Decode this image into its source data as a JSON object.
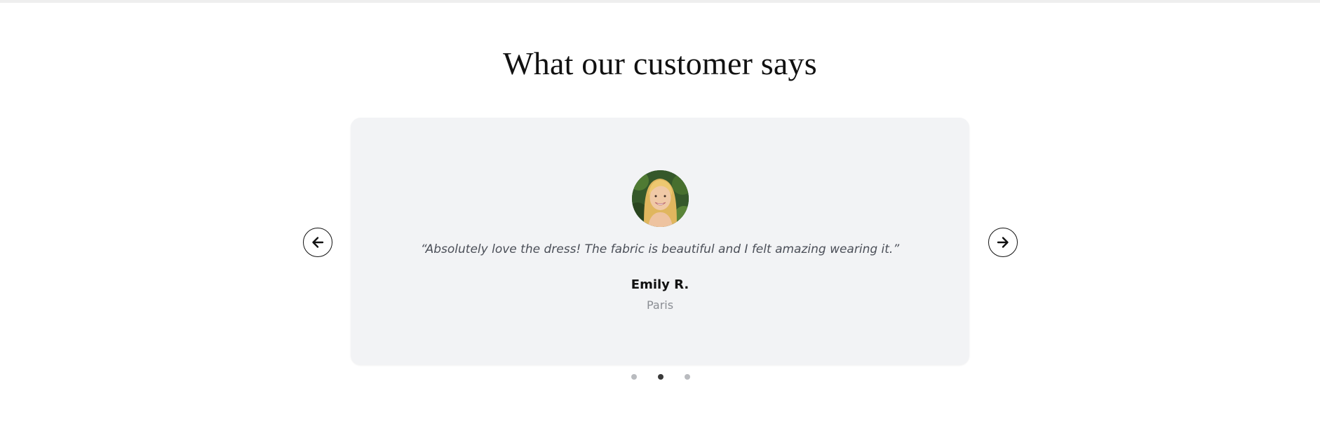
{
  "section": {
    "heading": "What our customer says"
  },
  "testimonial": {
    "quote": "“Absolutely love the dress! The fabric is beautiful and I felt amazing wearing it.”",
    "name": "Emily R.",
    "location": "Paris",
    "avatar_icon": "customer-portrait"
  },
  "controls": {
    "prev_icon": "arrow-left-icon",
    "next_icon": "arrow-right-icon"
  },
  "pagination": {
    "total": 3,
    "active_index": 1
  },
  "colors": {
    "card_background": "#f2f3f5",
    "quote_text": "#4b4f58",
    "location_text": "#8a8d93",
    "dot_inactive": "#b9bbbf",
    "dot_active": "#3a3a3a"
  }
}
